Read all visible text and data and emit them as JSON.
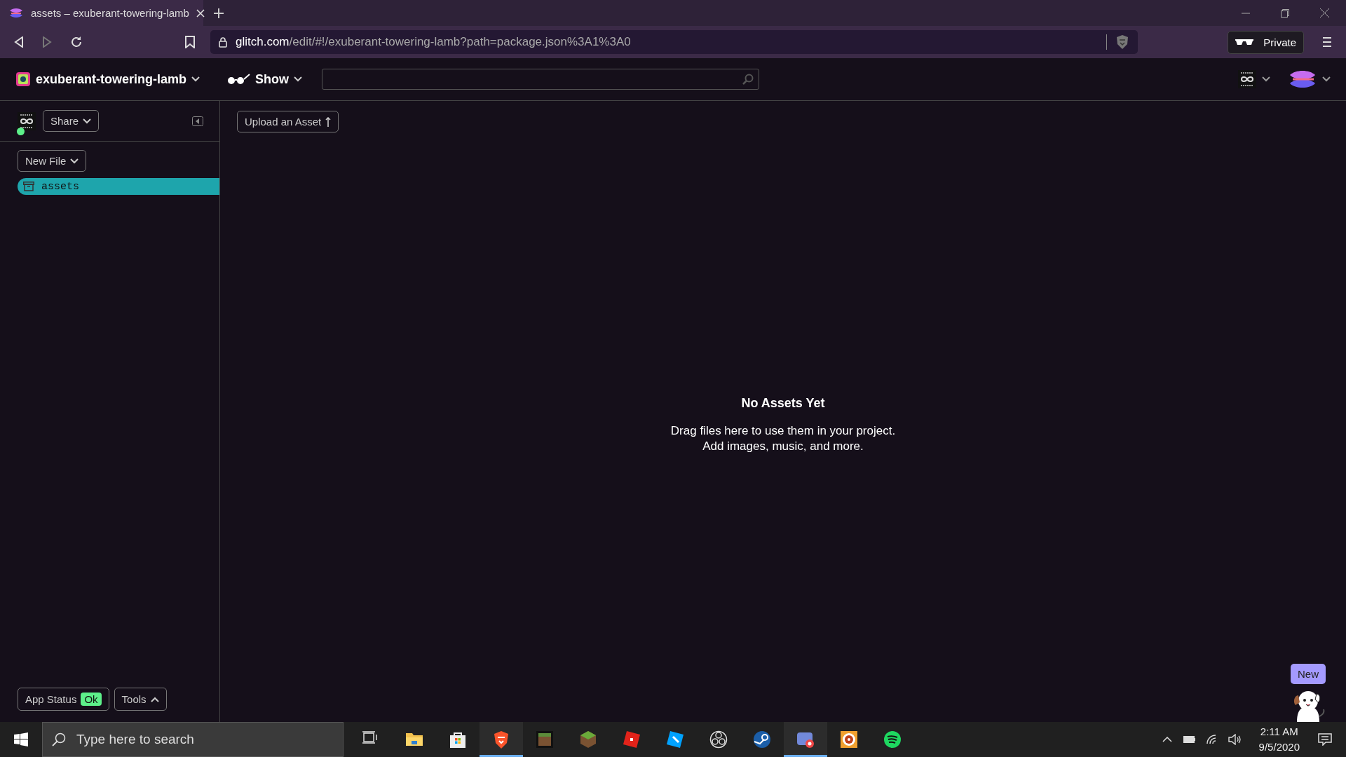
{
  "browser": {
    "tabs": [
      {
        "title": "assets – exuberant-towering-lamb",
        "selected": true
      }
    ],
    "address": {
      "host": "glitch.com",
      "path": "/edit/#!/exuberant-towering-lamb?path=package.json%3A1%3A0"
    },
    "private_label": "Private"
  },
  "header": {
    "project_name": "exuberant-towering-lamb",
    "show_label": "Show"
  },
  "sidebar": {
    "share_label": "Share",
    "online": true,
    "new_file_label": "New File",
    "files": [
      {
        "name": "assets",
        "selected": true
      }
    ],
    "app_status": {
      "label": "App Status",
      "badge": "Ok"
    },
    "tools_label": "Tools"
  },
  "main": {
    "upload_label": "Upload an Asset",
    "empty_title": "No Assets Yet",
    "empty_lines": [
      "Drag files here to use them in your project.",
      "Add images, music, and more."
    ],
    "new_badge": "New"
  },
  "taskbar": {
    "search_placeholder": "Type here to search",
    "apps": [
      {
        "kind": "taskview",
        "active": false
      },
      {
        "kind": "explorer",
        "active": false
      },
      {
        "kind": "store",
        "active": false
      },
      {
        "kind": "brave",
        "active": true
      },
      {
        "kind": "dirt",
        "active": false
      },
      {
        "kind": "grass",
        "active": false
      },
      {
        "kind": "roblox",
        "active": false
      },
      {
        "kind": "studio",
        "active": false
      },
      {
        "kind": "obs",
        "active": false
      },
      {
        "kind": "steam",
        "active": false
      },
      {
        "kind": "discord",
        "active": true
      },
      {
        "kind": "media",
        "active": false
      },
      {
        "kind": "spotify",
        "active": false
      }
    ],
    "time": "2:11 AM",
    "date": "9/5/2020"
  }
}
